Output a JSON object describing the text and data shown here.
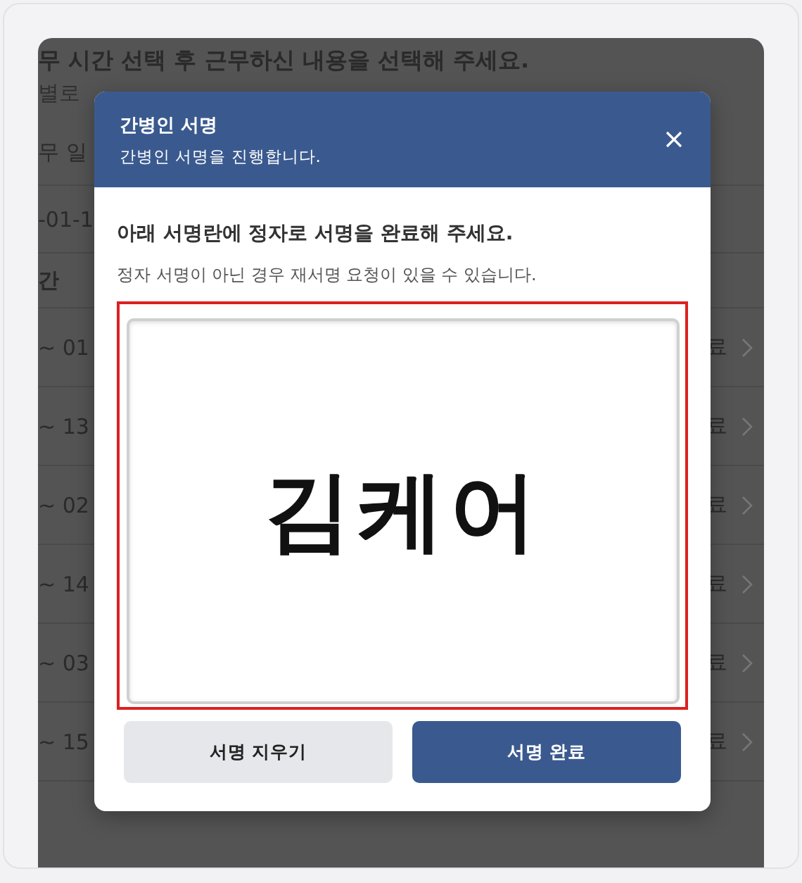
{
  "background_page": {
    "heading": "무 시간 선택 후 근무하신 내용을 선택해 주세요.",
    "subheading": "별로",
    "field_label": "무 일",
    "date_value": "-01-1",
    "section_label": "간",
    "rows": [
      {
        "time": "~ 01",
        "status": "료"
      },
      {
        "time": "~ 13",
        "status": "료"
      },
      {
        "time": "~ 02",
        "status": "료"
      },
      {
        "time": "~ 14",
        "status": "료"
      },
      {
        "time": "~ 03",
        "status": "료"
      },
      {
        "time": "~ 15",
        "status": "료"
      }
    ]
  },
  "dialog": {
    "title": "간병인 서명",
    "subtitle": "간병인 서명을 진행합니다.",
    "instruction": "아래 서명란에 정자로 서명을 완료해 주세요.",
    "note": "정자 서명이 아닌 경우 재서명 요청이 있을 수 있습니다.",
    "signature": "김케어",
    "buttons": [
      {
        "label": "서명 지우기",
        "kind": "secondary"
      },
      {
        "label": "서명 완료",
        "kind": "primary"
      }
    ]
  }
}
